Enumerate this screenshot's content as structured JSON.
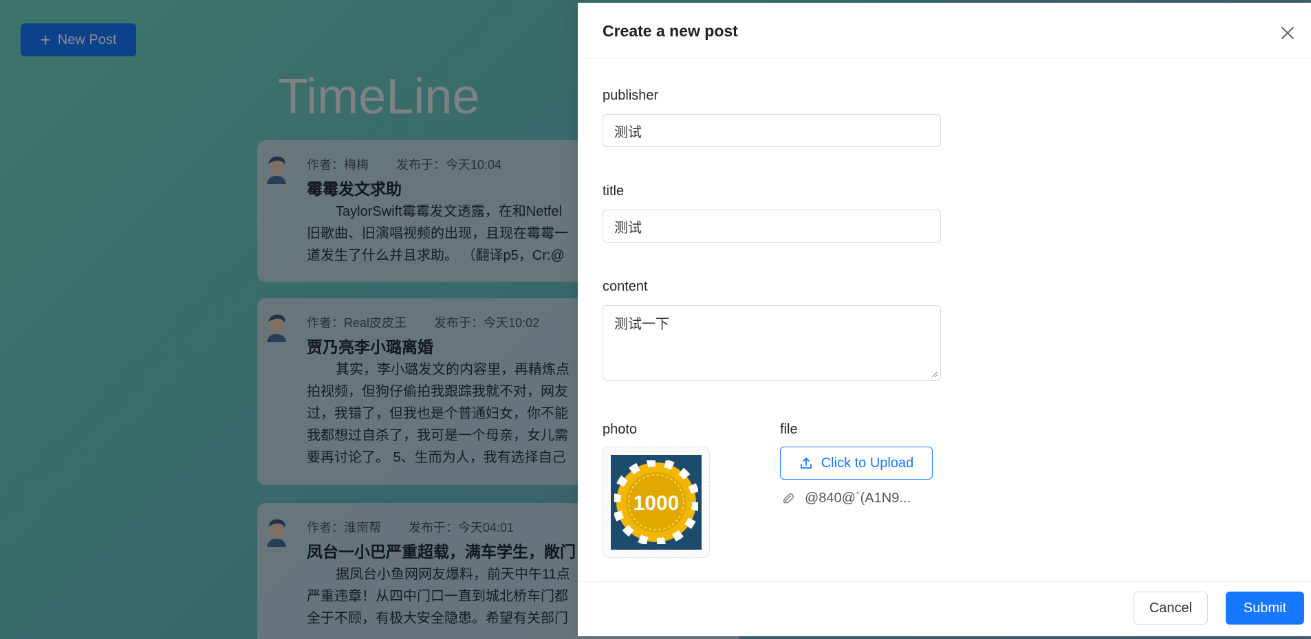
{
  "background": {
    "new_post_label": "New Post",
    "timeline_title": "TimeLine",
    "posts": [
      {
        "author": "作者：梅梅",
        "time": "发布于：今天10:04",
        "title": "霉霉发文求助",
        "lines": [
          "TaylorSwift霉霉发文透露，在和Netfel",
          "旧歌曲、旧演唱视频的出现，且现在霉霉一",
          "道发生了什么并且求助。 （翻译p5，Cr:@"
        ]
      },
      {
        "author": "作者：Real皮皮王",
        "time": "发布于：今天10:02",
        "title": "贾乃亮李小璐离婚",
        "lines": [
          "其实，李小璐发文的内容里，再精炼点",
          "拍视频，但狗仔偷拍我跟踪我就不对，网友",
          "过，我错了，但我也是个普通妇女，你不能",
          "我都想过自杀了，我可是一个母亲，女儿需",
          "要再讨论了。 5、生而为人，我有选择自己"
        ]
      },
      {
        "author": "作者：淮南帮",
        "time": "发布于：今天04:01",
        "title": "凤台一小巴严重超载，满车学生，敞门",
        "lines": [
          "据凤台小鱼网网友爆料，前天中午11点",
          "严重违章！从四中门口一直到城北桥车门都",
          "全于不顾，有极大安全隐患。希望有关部门"
        ]
      }
    ]
  },
  "drawer": {
    "title": "Create a new post",
    "publisher_label": "publisher",
    "publisher_value": "测试",
    "title_label": "title",
    "title_value": "测试",
    "content_label": "content",
    "content_value": "测试一下",
    "photo_label": "photo",
    "photo_text": "1000",
    "file_label": "file",
    "upload_label": "Click to Upload",
    "file_name": "@840@`(A1N9...",
    "cancel_label": "Cancel",
    "submit_label": "Submit"
  },
  "colors": {
    "primary": "#1677ff",
    "chip_gold": "#f2b705",
    "chip_bg": "#1d4b6e"
  }
}
